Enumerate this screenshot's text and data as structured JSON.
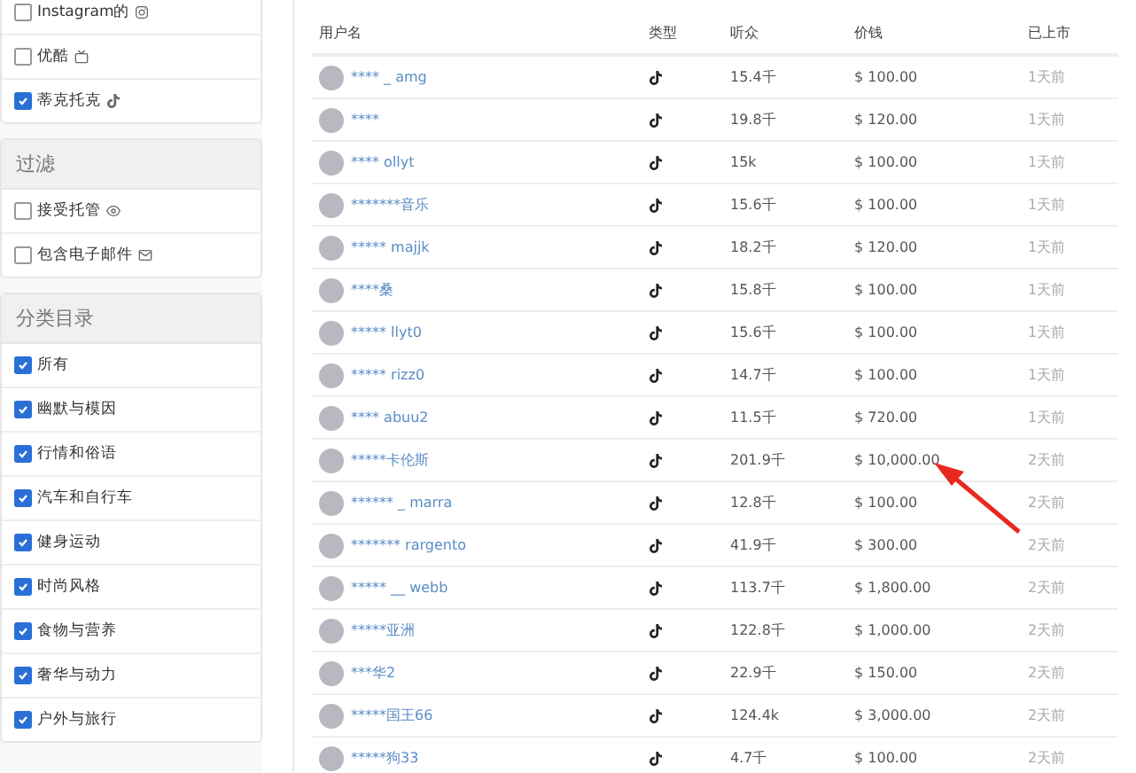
{
  "sidebar": [
    {
      "items": [
        {
          "label": "Instagram的",
          "checked": false,
          "kind": "instagram"
        },
        {
          "label": "优酷",
          "checked": false,
          "kind": "youku"
        },
        {
          "label": "蒂克托克",
          "checked": true,
          "kind": "tiktok"
        }
      ]
    },
    {
      "title": "过滤",
      "items": [
        {
          "label": "接受托管",
          "checked": false,
          "kind": "eye"
        },
        {
          "label": "包含电子邮件",
          "checked": false,
          "kind": "mail"
        }
      ]
    },
    {
      "title": "分类目录",
      "items": [
        {
          "label": "所有",
          "checked": true
        },
        {
          "label": "幽默与模因",
          "checked": true
        },
        {
          "label": "行情和俗语",
          "checked": true
        },
        {
          "label": "汽车和自行车",
          "checked": true
        },
        {
          "label": "健身运动",
          "checked": true
        },
        {
          "label": "时尚风格",
          "checked": true
        },
        {
          "label": "食物与营养",
          "checked": true
        },
        {
          "label": "奢华与动力",
          "checked": true
        },
        {
          "label": "户外与旅行",
          "checked": true
        }
      ]
    }
  ],
  "table": {
    "columns": [
      "用户名",
      "类型",
      "听众",
      "价钱",
      "已上市"
    ],
    "rows": [
      {
        "user": "**** _ amg",
        "kind": "tiktok",
        "audience": "15.4千",
        "price": "$ 100.00",
        "listed": "1天前"
      },
      {
        "user": "****",
        "kind": "tiktok",
        "audience": "19.8千",
        "price": "$ 120.00",
        "listed": "1天前"
      },
      {
        "user": "**** ollyt",
        "kind": "tiktok",
        "audience": "15k",
        "price": "$ 100.00",
        "listed": "1天前"
      },
      {
        "user": "*******音乐",
        "kind": "tiktok",
        "audience": "15.6千",
        "price": "$ 100.00",
        "listed": "1天前"
      },
      {
        "user": "***** majjk",
        "kind": "tiktok",
        "audience": "18.2千",
        "price": "$ 120.00",
        "listed": "1天前"
      },
      {
        "user": "****桑",
        "kind": "tiktok",
        "audience": "15.8千",
        "price": "$ 100.00",
        "listed": "1天前"
      },
      {
        "user": "***** llyt0",
        "kind": "tiktok",
        "audience": "15.6千",
        "price": "$ 100.00",
        "listed": "1天前"
      },
      {
        "user": "***** rizz0",
        "kind": "tiktok",
        "audience": "14.7千",
        "price": "$ 100.00",
        "listed": "1天前"
      },
      {
        "user": "**** abuu2",
        "kind": "tiktok",
        "audience": "11.5千",
        "price": "$ 720.00",
        "listed": "1天前"
      },
      {
        "user": "*****卡伦斯",
        "kind": "tiktok",
        "audience": "201.9千",
        "price": "$ 10,000.00",
        "listed": "2天前"
      },
      {
        "user": "****** _ marra",
        "kind": "tiktok",
        "audience": "12.8千",
        "price": "$ 100.00",
        "listed": "2天前"
      },
      {
        "user": "******* rargento",
        "kind": "tiktok",
        "audience": "41.9千",
        "price": "$ 300.00",
        "listed": "2天前"
      },
      {
        "user": "***** __ webb",
        "kind": "tiktok",
        "audience": "113.7千",
        "price": "$ 1,800.00",
        "listed": "2天前"
      },
      {
        "user": "*****亚洲",
        "kind": "tiktok",
        "audience": "122.8千",
        "price": "$ 1,000.00",
        "listed": "2天前"
      },
      {
        "user": "***华2",
        "kind": "tiktok",
        "audience": "22.9千",
        "price": "$ 150.00",
        "listed": "2天前"
      },
      {
        "user": "*****国王66",
        "kind": "tiktok",
        "audience": "124.4k",
        "price": "$ 3,000.00",
        "listed": "2天前"
      },
      {
        "user": "*****狗33",
        "kind": "tiktok",
        "audience": "4.7千",
        "price": "$ 100.00",
        "listed": "2天前"
      }
    ]
  }
}
